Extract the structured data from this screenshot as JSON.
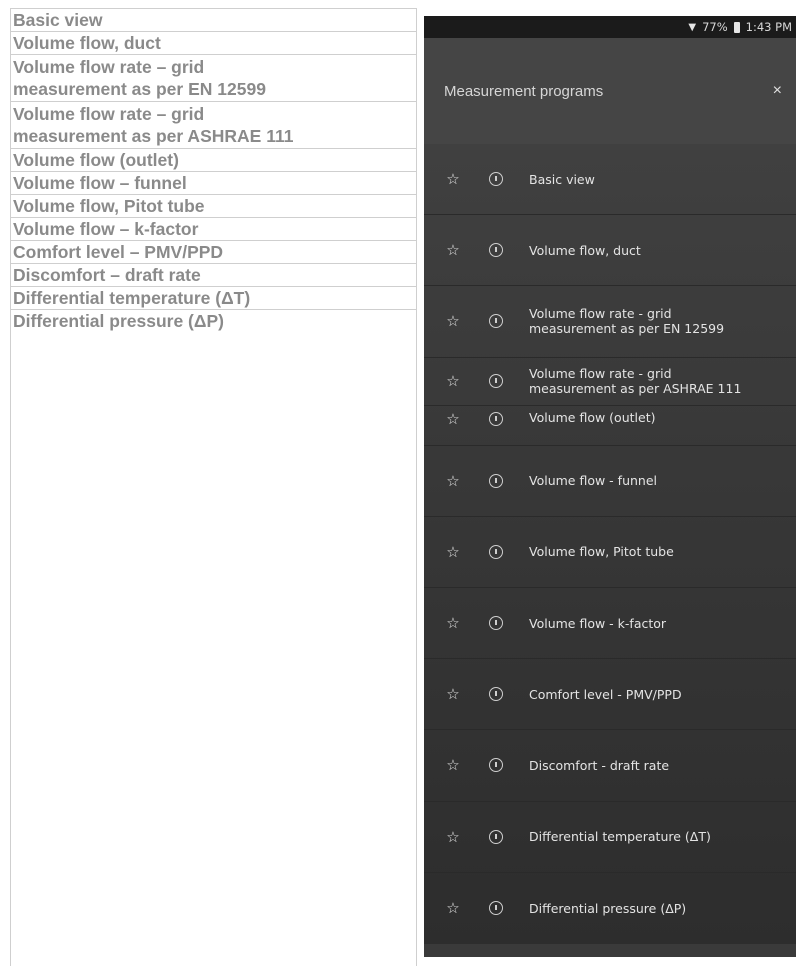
{
  "table_rows": [
    "Basic view",
    "Volume flow, duct",
    "Volume flow rate – grid measurement as per EN 12599",
    "Volume flow rate – grid measurement as per ASHRAE 111",
    "Volume flow (outlet)",
    "Volume flow – funnel",
    "Volume flow, Pitot tube",
    "Volume flow – k-factor",
    "Comfort level – PMV/PPD",
    "Discomfort – draft rate",
    "Differential temperature (ΔT)",
    "Differential pressure (ΔP)"
  ],
  "table_rows_display": {
    "r0": "Basic view",
    "r1": "Volume flow, duct",
    "r2a": "Volume flow rate – grid",
    "r2b": "measurement as per EN 12599",
    "r3a": "Volume flow rate – grid",
    "r3b": "measurement as per ASHRAE 111",
    "r4": "Volume flow (outlet)",
    "r5": "Volume flow – funnel",
    "r6": "Volume flow, Pitot tube",
    "r7": "Volume flow – k-factor",
    "r8": "Comfort level – PMV/PPD",
    "r9": "Discomfort – draft rate",
    "r10": "Differential temperature (ΔT)",
    "r11": "Differential pressure (ΔP)"
  },
  "phone": {
    "status": {
      "battery": "77%",
      "time": "1:43 PM",
      "wifi_icon": "wifi-icon",
      "battery_icon": "battery-icon"
    },
    "header": {
      "title": "Measurement programs",
      "close_glyph": "×"
    },
    "star_glyph": "☆",
    "items": {
      "i0": "Basic view",
      "i1": "Volume flow, duct",
      "i2a": "Volume flow rate - grid",
      "i2b": "measurement as per EN 12599",
      "i3a": "Volume flow rate - grid",
      "i3b": "measurement as per ASHRAE 111",
      "i4": "Volume flow (outlet)",
      "i5": "Volume flow - funnel",
      "i6": "Volume flow, Pitot tube",
      "i7": "Volume flow - k-factor",
      "i8": "Comfort level - PMV/PPD",
      "i9": "Discomfort - draft rate",
      "i10": "Differential temperature (ΔT)",
      "i11": "Differential pressure (ΔP)"
    }
  },
  "colors": {
    "table_text": "#8a8a8a",
    "table_border": "#cfcfcf",
    "phone_bg": "#3a3a3a",
    "statusbar_bg": "#1b1b1b"
  }
}
